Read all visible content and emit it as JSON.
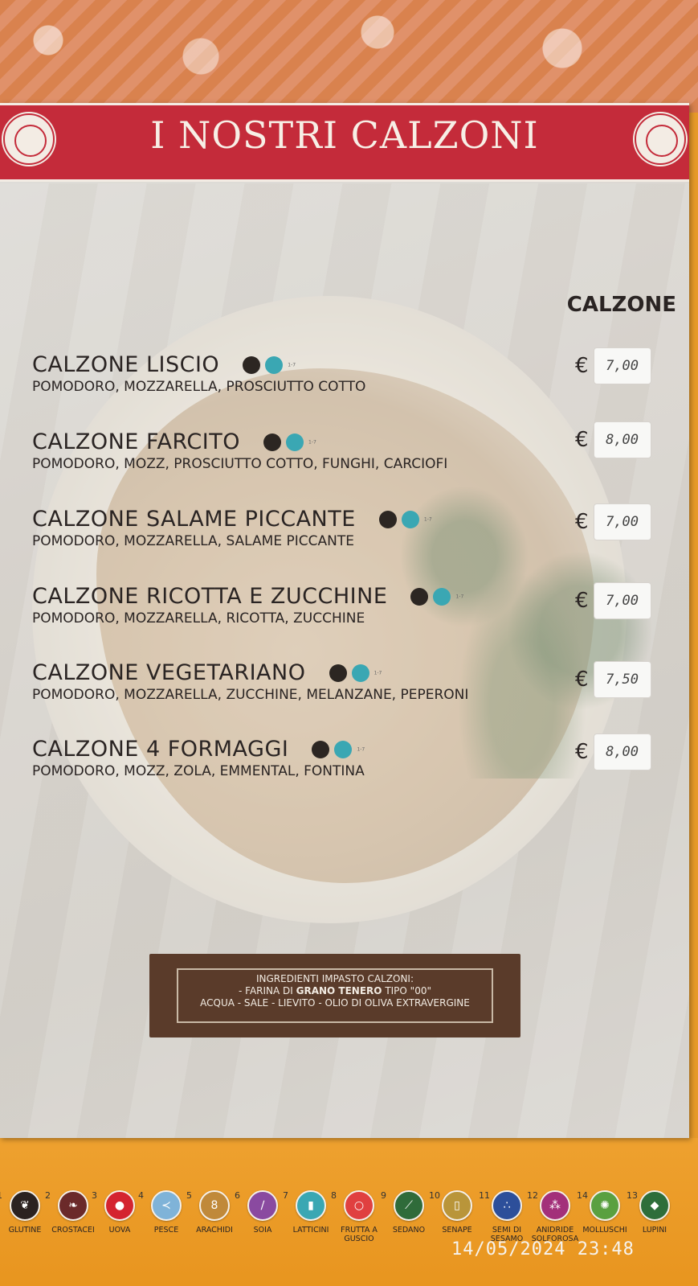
{
  "header": {
    "title": "I NOSTRI CALZONI"
  },
  "section_title": "CALZONE",
  "items": [
    {
      "name": "CALZONE LISCIO",
      "desc": "POMODORO, MOZZARELLA, PROSCIUTTO COTTO",
      "price": "7,00",
      "allergens": "1-7"
    },
    {
      "name": "CALZONE FARCITO",
      "desc": "POMODORO, MOZZ, PROSCIUTTO COTTO, FUNGHI, CARCIOFI",
      "price": "8,00",
      "allergens": "1-7"
    },
    {
      "name": "CALZONE SALAME PICCANTE",
      "desc": "POMODORO, MOZZARELLA, SALAME PICCANTE",
      "price": "7,00",
      "allergens": "1-7"
    },
    {
      "name": "CALZONE RICOTTA E ZUCCHINE",
      "desc": "POMODORO, MOZZARELLA, RICOTTA, ZUCCHINE",
      "price": "7,00",
      "allergens": "1-7"
    },
    {
      "name": "CALZONE VEGETARIANO",
      "desc": "POMODORO, MOZZARELLA, ZUCCHINE, MELANZANE, PEPERONI",
      "price": "7,50",
      "allergens": "1-7"
    },
    {
      "name": "CALZONE 4 FORMAGGI",
      "desc": "POMODORO, MOZZ, ZOLA, EMMENTAL, FONTINA",
      "price": "8,00",
      "allergens": "1-7"
    }
  ],
  "currency": "€",
  "dough": {
    "line1": "INGREDIENTI IMPASTO CALZONI:",
    "line2_prefix": "- FARINA DI ",
    "line2_bold": "GRANO TENERO",
    "line2_suffix": " TIPO \"00\"",
    "line3": "ACQUA - SALE - LIEVITO - OLIO DI OLIVA EXTRAVERGINE"
  },
  "allergens": [
    {
      "num": "1",
      "label": "GLUTINE",
      "color": "#2b2220",
      "icon": "bread-icon"
    },
    {
      "num": "2",
      "label": "CROSTACEI",
      "color": "#6b2a2a",
      "icon": "shrimp-icon"
    },
    {
      "num": "3",
      "label": "UOVA",
      "color": "#d42430",
      "icon": "egg-icon"
    },
    {
      "num": "4",
      "label": "PESCE",
      "color": "#7fb3d8",
      "icon": "fish-icon"
    },
    {
      "num": "5",
      "label": "ARACHIDI",
      "color": "#c0893a",
      "icon": "peanut-icon"
    },
    {
      "num": "6",
      "label": "SOIA",
      "color": "#8a4aa0",
      "icon": "soy-icon"
    },
    {
      "num": "7",
      "label": "LATTICINI",
      "color": "#3aa7b3",
      "icon": "milk-icon"
    },
    {
      "num": "8",
      "label": "FRUTTA A GUSCIO",
      "color": "#e04040",
      "icon": "nut-icon"
    },
    {
      "num": "9",
      "label": "SEDANO",
      "color": "#2f6b3a",
      "icon": "celery-icon"
    },
    {
      "num": "10",
      "label": "SENAPE",
      "color": "#b9953a",
      "icon": "mustard-icon"
    },
    {
      "num": "11",
      "label": "SEMI DI SESAMO",
      "color": "#2d4f9a",
      "icon": "sesame-icon"
    },
    {
      "num": "12",
      "label": "ANIDRIDE SOLFOROSA",
      "color": "#a3307a",
      "icon": "sulphite-icon"
    },
    {
      "num": "14",
      "label": "MOLLUSCHI",
      "color": "#5aa040",
      "icon": "shell-icon"
    },
    {
      "num": "13",
      "label": "LUPINI",
      "color": "#2e6e3a",
      "icon": "lupin-icon"
    }
  ],
  "timestamp": "14/05/2024  23:48"
}
